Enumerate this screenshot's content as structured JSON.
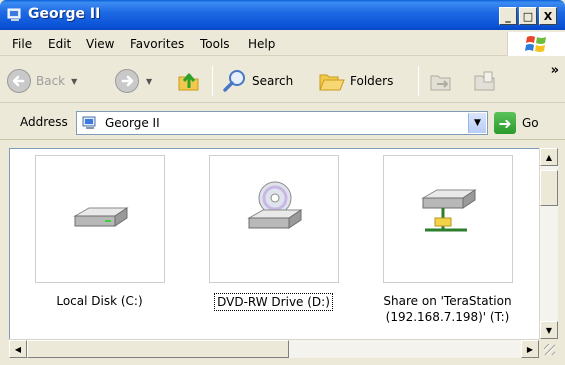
{
  "window": {
    "title": "George II"
  },
  "caption_buttons": {
    "minimize": "_",
    "maximize": "□",
    "close": "X"
  },
  "menu": {
    "items": [
      "File",
      "Edit",
      "View",
      "Favorites",
      "Tools",
      "Help"
    ]
  },
  "toolbar": {
    "back_label": "Back",
    "search_label": "Search",
    "folders_label": "Folders",
    "overflow": "»"
  },
  "address": {
    "label": "Address",
    "value": "George II",
    "go_label": "Go"
  },
  "items": [
    {
      "label": "Local Disk (C:)",
      "icon": "hard-disk-icon",
      "selected": false
    },
    {
      "label": "DVD-RW Drive (D:)",
      "icon": "dvd-drive-icon",
      "selected": true
    },
    {
      "label_line1": "Share on 'TeraStation",
      "label_line2": "(192.168.7.198)' (T:)",
      "icon": "network-drive-icon",
      "selected": false
    }
  ],
  "colors": {
    "titlebar": "#0a52d6",
    "chrome": "#ece9d8",
    "selection_border": "#000000"
  }
}
